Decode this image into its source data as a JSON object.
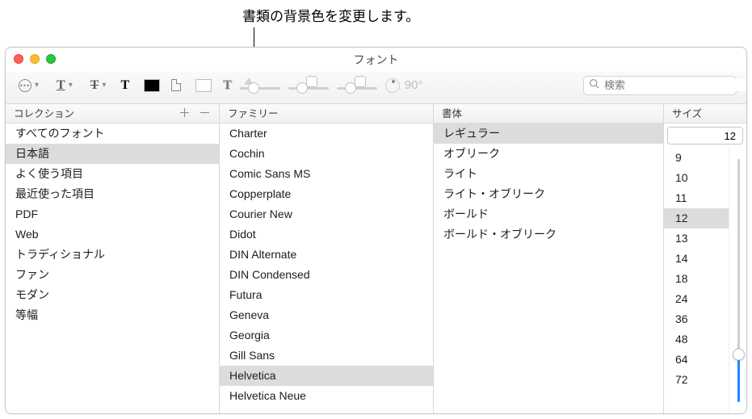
{
  "annotation": "書類の背景色を変更します。",
  "window_title": "フォント",
  "search": {
    "placeholder": "検索",
    "value": ""
  },
  "toolbar": {
    "angle": "90°"
  },
  "columns": {
    "collection": {
      "header": "コレクション",
      "items": [
        "すべてのフォント",
        "日本語",
        "よく使う項目",
        "最近使った項目",
        "PDF",
        "Web",
        "トラディショナル",
        "ファン",
        "モダン",
        "等幅"
      ],
      "selected_index": 1
    },
    "family": {
      "header": "ファミリー",
      "items": [
        "Charter",
        "Cochin",
        "Comic Sans MS",
        "Copperplate",
        "Courier New",
        "Didot",
        "DIN Alternate",
        "DIN Condensed",
        "Futura",
        "Geneva",
        "Georgia",
        "Gill Sans",
        "Helvetica",
        "Helvetica Neue"
      ],
      "selected_index": 12
    },
    "typeface": {
      "header": "書体",
      "items": [
        "レギュラー",
        "オブリーク",
        "ライト",
        "ライト・オブリーク",
        "ボールド",
        "ボールド・オブリーク"
      ],
      "selected_index": 0
    },
    "size": {
      "header": "サイズ",
      "current": "12",
      "items": [
        "9",
        "10",
        "11",
        "12",
        "13",
        "14",
        "18",
        "24",
        "36",
        "48",
        "64",
        "72"
      ],
      "selected_index": 3
    }
  }
}
